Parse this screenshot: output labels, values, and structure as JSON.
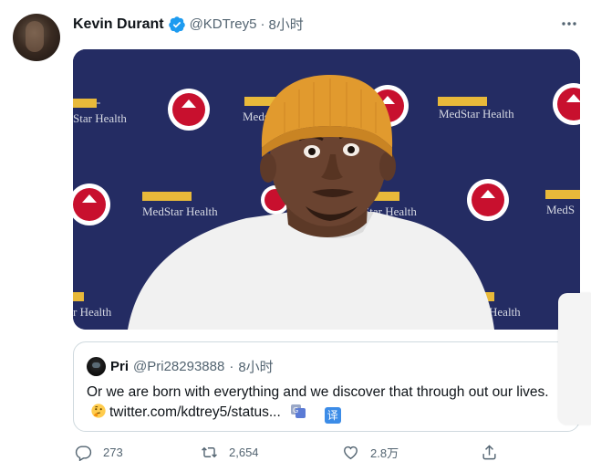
{
  "tweet": {
    "author_name": "Kevin Durant",
    "author_handle": "@KDTrey5",
    "separator": "·",
    "time": "8小时"
  },
  "media": {
    "backdrop_text": "MedStar Health",
    "backdrop_text_partial_left": "r Health",
    "backdrop_text_partial_top": "Star Health",
    "backdrop_text_partial_mid": "Meds",
    "backdrop_text_partial_mid2": "MedS",
    "backdrop_text_partial_center": "Star Health",
    "colors": {
      "backdrop": "#242c63",
      "beanie": "#e19a2e",
      "shirt": "#f2f2f2",
      "skin": "#6a4330"
    }
  },
  "quote": {
    "author_name": "Pri",
    "author_handle": "@Pri28293888",
    "separator": "·",
    "time": "8小时",
    "text": "Or we are born with everything and we discover that through out our lives.",
    "link": "twitter.com/kdtrey5/status...",
    "translate_label": "译"
  },
  "actions": {
    "replies": "273",
    "retweets": "2,654",
    "likes": "2.8万"
  },
  "colors": {
    "verified": "#1d9bf0",
    "muted": "#536471",
    "text": "#0f1419",
    "border": "#cfd9de"
  }
}
